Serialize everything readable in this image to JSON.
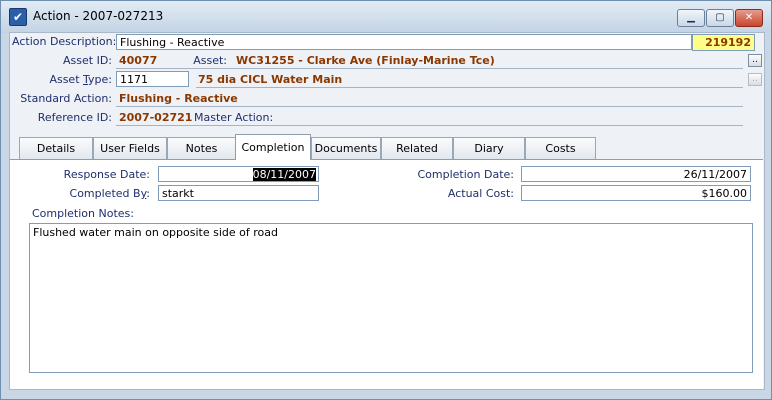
{
  "window": {
    "title": "Action - 2007-027213"
  },
  "form": {
    "action_description_label": "Action Description:",
    "action_description_value": "Flushing - Reactive",
    "id_badge": "219192",
    "asset_id_label": "Asset ID:",
    "asset_id_value": "40077",
    "asset_label": "Asset:",
    "asset_value": "WC31255 - Clarke Ave (Finlay-Marine Tce)",
    "asset_type_label_pre": "Asset ",
    "asset_type_label_u": "T",
    "asset_type_label_post": "ype:",
    "asset_type_value": "1171",
    "asset_type_desc": "75 dia CICL Water Main",
    "standard_action_label": "Standard Action:",
    "standard_action_value": "Flushing - Reactive",
    "reference_id_label": "Reference ID:",
    "reference_id_value": "2007-02721",
    "master_action_label": "Master Action:",
    "browse_btn": "..",
    "browse_btn2": ".."
  },
  "tabs": [
    "Details",
    "User Fields",
    "Notes",
    "Completion",
    "Documents",
    "Related Items",
    "Diary",
    "Costs"
  ],
  "completion": {
    "response_date_label": "Response Date:",
    "response_date_value": "08/11/2007",
    "completed_by_label_pre": "Completed B",
    "completed_by_label_u": "y",
    "completed_by_label_post": ":",
    "completed_by_value": "starkt",
    "completion_date_label": "Completion Date:",
    "completion_date_value": "26/11/2007",
    "actual_cost_label": "Actual Cost:",
    "actual_cost_value": "$160.00",
    "completion_notes_label": "Completion Notes:",
    "completion_notes_value": "Flushed water main on opposite side of road"
  }
}
